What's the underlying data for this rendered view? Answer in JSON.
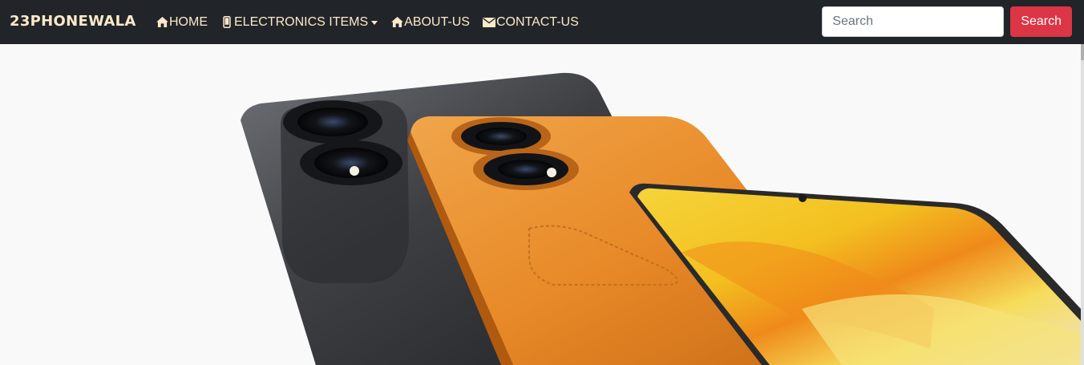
{
  "navbar": {
    "brand": "23PHONEWALA",
    "items": [
      {
        "label": "HOME",
        "icon": "home-icon"
      },
      {
        "label": "ELECTRONICS ITEMS",
        "icon": "mobile-icon",
        "dropdown": true
      },
      {
        "label": "ABOUT-US",
        "icon": "home-icon"
      },
      {
        "label": "CONTACT-US",
        "icon": "envelope-icon"
      }
    ],
    "search": {
      "placeholder": "Search",
      "value": "",
      "button_label": "Search"
    }
  },
  "colors": {
    "navbar_bg": "#212529",
    "nav_text": "#fde9c9",
    "search_button": "#dc3545"
  },
  "hero": {
    "image": "phones-carousel-image"
  }
}
